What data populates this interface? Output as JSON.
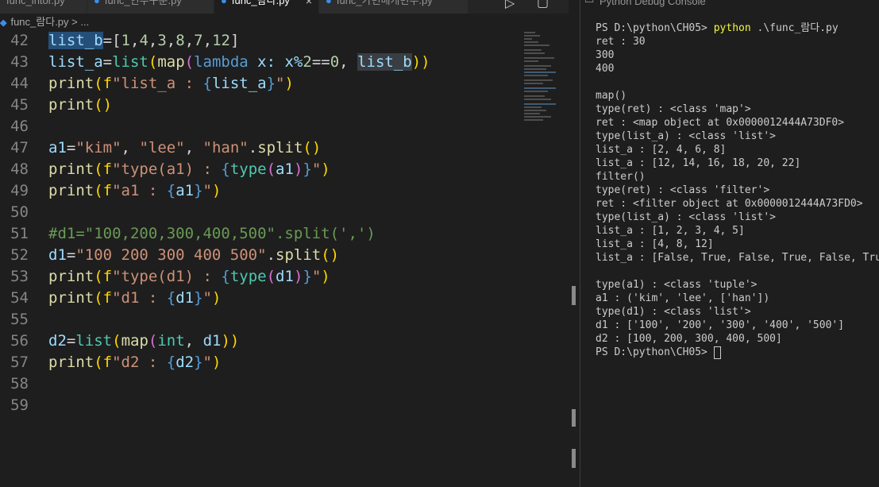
{
  "editor": {
    "tabs": [
      {
        "label": "func_intor.py",
        "active": false
      },
      {
        "label": "func_인수구분.py",
        "active": false
      },
      {
        "label": "func_람다.py",
        "active": true
      },
      {
        "label": "func_가변매개변수.py",
        "active": false
      }
    ],
    "tab_close_symbol": "×",
    "breadcrumb": {
      "file": "func_람다.py",
      "rest": "...",
      "separator": ">"
    },
    "lines": [
      {
        "no": "42"
      },
      {
        "no": "43"
      },
      {
        "no": "44"
      },
      {
        "no": "45"
      },
      {
        "no": "46"
      },
      {
        "no": "47"
      },
      {
        "no": "48"
      },
      {
        "no": "49"
      },
      {
        "no": "50"
      },
      {
        "no": "51"
      },
      {
        "no": "52"
      },
      {
        "no": "53"
      },
      {
        "no": "54"
      },
      {
        "no": "55"
      },
      {
        "no": "56"
      },
      {
        "no": "57"
      },
      {
        "no": "58"
      },
      {
        "no": "59"
      }
    ],
    "code": {
      "l42": [
        "list_b",
        "=[",
        "1",
        ",",
        "4",
        ",",
        "3",
        ",",
        "8",
        ",",
        "7",
        ",",
        "12",
        "]"
      ],
      "l43": [
        "list_a",
        "=",
        "list",
        "(",
        "map",
        "(",
        "lambda",
        " x: x%",
        "2",
        "==",
        "0",
        ", ",
        "list_b",
        "))"
      ],
      "l44": [
        "print",
        "(f",
        "\"list_a : ",
        "{",
        "list_a",
        "}",
        "\"",
        ")"
      ],
      "l45": [
        "print",
        "()"
      ],
      "l47": [
        "a1",
        "=",
        "\"kim\"",
        ", ",
        "\"lee\"",
        ", ",
        "\"han\"",
        ".",
        "split",
        "()"
      ],
      "l48": [
        "print",
        "(f",
        "\"type(a1) : ",
        "{",
        "type",
        "(",
        "a1",
        ")",
        "}",
        "\"",
        ")"
      ],
      "l49": [
        "print",
        "(f",
        "\"a1 : ",
        "{",
        "a1",
        "}",
        "\"",
        ")"
      ],
      "l51": [
        "#d1=\"100,200,300,400,500\".split(',')"
      ],
      "l52": [
        "d1",
        "=",
        "\"100 200 300 400 500\"",
        ".",
        "split",
        "()"
      ],
      "l53": [
        "print",
        "(f",
        "\"type(d1) : ",
        "{",
        "type",
        "(",
        "d1",
        ")",
        "}",
        "\"",
        ")"
      ],
      "l54": [
        "print",
        "(f",
        "\"d1 : ",
        "{",
        "d1",
        "}",
        "\"",
        ")"
      ],
      "l56": [
        "d2",
        "=",
        "list",
        "(",
        "map",
        "(",
        "int",
        ", ",
        "d1",
        "))"
      ],
      "l57": [
        "print",
        "(f",
        "\"d2 : ",
        "{",
        "d2",
        "}",
        "\"",
        ")"
      ]
    }
  },
  "terminal": {
    "title": "Python Debug Console",
    "prompt": "PS D:\\python\\CH05> ",
    "command": "python",
    "command_arg": " .\\func_람다.py",
    "output": [
      "ret : 30",
      "300",
      "400",
      "",
      "map()",
      "type(ret) : <class 'map'>",
      "ret : <map object at 0x0000012444A73DF0>",
      "type(list_a) : <class 'list'>",
      "list_a : [2, 4, 6, 8]",
      "list_a : [12, 14, 16, 18, 20, 22]",
      "filter()",
      "type(ret) : <class 'filter'>",
      "ret : <filter object at 0x0000012444A73FD0>",
      "type(list_a) : <class 'list'>",
      "list_a : [1, 2, 3, 4, 5]",
      "list_a : [4, 8, 12]",
      "list_a : [False, True, False, True, False, True]",
      "",
      "type(a1) : <class 'tuple'>",
      "a1 : ('kim', 'lee', ['han'])",
      "type(d1) : <class 'list'>",
      "d1 : ['100', '200', '300', '400', '500']",
      "d2 : [100, 200, 300, 400, 500]"
    ],
    "final_prompt": "PS D:\\python\\CH05> "
  }
}
